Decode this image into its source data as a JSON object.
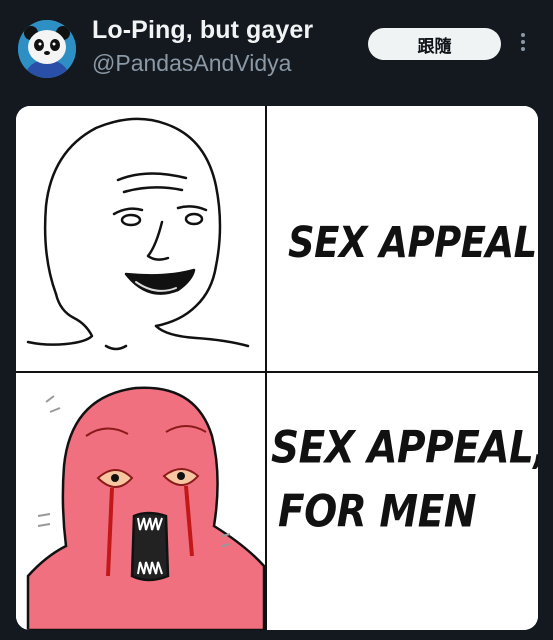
{
  "tweet": {
    "display_name": "Lo-Ping, but gayer",
    "handle": "@PandasAndVidya",
    "follow_label": "跟隨"
  },
  "meme": {
    "top_caption": "SEX APPEAL",
    "bottom_caption_line1": "SEX APPEAL,",
    "bottom_caption_line2": "FOR MEN"
  },
  "colors": {
    "background": "#14191f",
    "angry_face": "#f07080"
  },
  "icons": [
    "panda-avatar",
    "more-options-icon"
  ]
}
